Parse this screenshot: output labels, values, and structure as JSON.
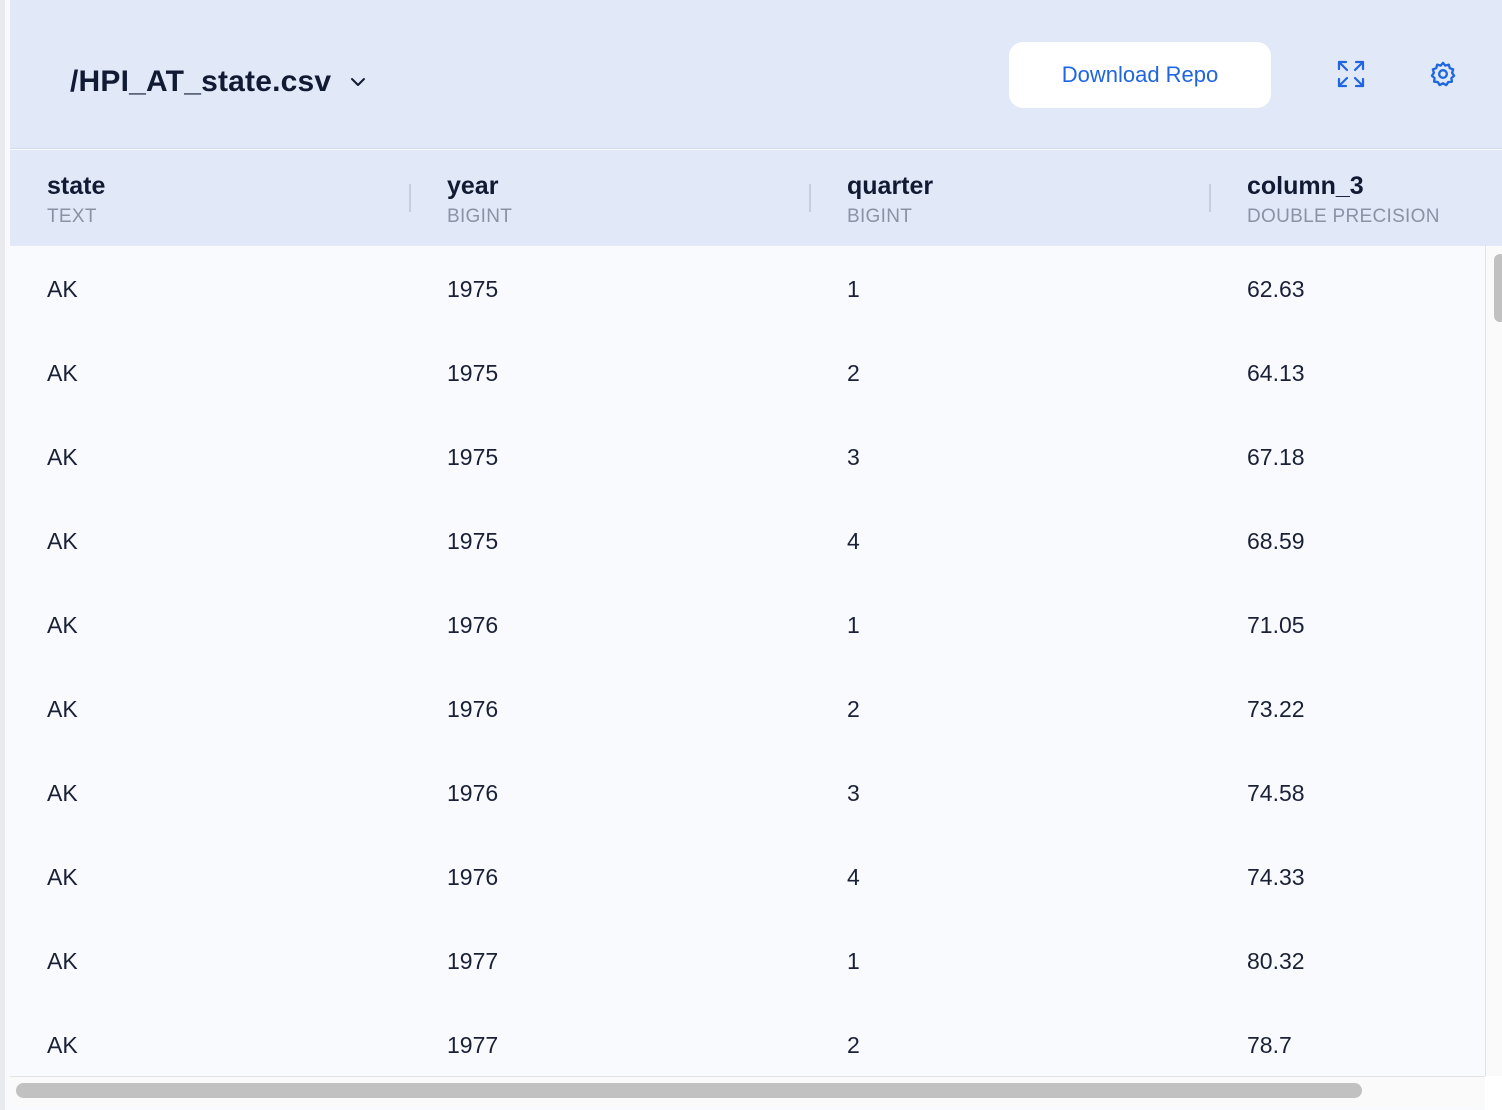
{
  "header": {
    "file_name": "/HPI_AT_state.csv",
    "download_label": "Download Repo"
  },
  "icons": {
    "chevron": "chevron-down-icon",
    "expand": "expand-icon",
    "settings": "gear-icon"
  },
  "colors": {
    "accent": "#1f66e0",
    "header_bg": "#e1e8f8",
    "body_bg": "#f8fafe"
  },
  "columns": [
    {
      "name": "state",
      "type": "TEXT"
    },
    {
      "name": "year",
      "type": "BIGINT"
    },
    {
      "name": "quarter",
      "type": "BIGINT"
    },
    {
      "name": "column_3",
      "type": "DOUBLE PRECISION"
    }
  ],
  "rows": [
    [
      "AK",
      "1975",
      "1",
      "62.63"
    ],
    [
      "AK",
      "1975",
      "2",
      "64.13"
    ],
    [
      "AK",
      "1975",
      "3",
      "67.18"
    ],
    [
      "AK",
      "1975",
      "4",
      "68.59"
    ],
    [
      "AK",
      "1976",
      "1",
      "71.05"
    ],
    [
      "AK",
      "1976",
      "2",
      "73.22"
    ],
    [
      "AK",
      "1976",
      "3",
      "74.58"
    ],
    [
      "AK",
      "1976",
      "4",
      "74.33"
    ],
    [
      "AK",
      "1977",
      "1",
      "80.32"
    ],
    [
      "AK",
      "1977",
      "2",
      "78.7"
    ]
  ]
}
